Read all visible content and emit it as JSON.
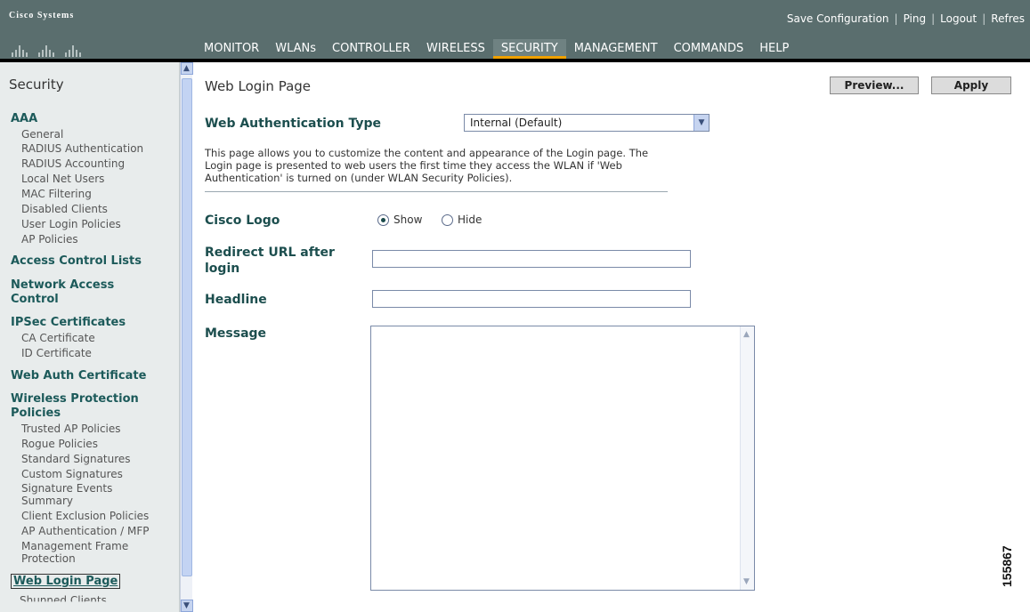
{
  "brand": {
    "name": "Cisco Systems"
  },
  "utility_links": [
    "Save Configuration",
    "Ping",
    "Logout",
    "Refres"
  ],
  "nav": {
    "items": [
      "MONITOR",
      "WLANs",
      "CONTROLLER",
      "WIRELESS",
      "SECURITY",
      "MANAGEMENT",
      "COMMANDS",
      "HELP"
    ],
    "active": "SECURITY"
  },
  "sidebar": {
    "title": "Security",
    "aaa": {
      "heading": "AAA",
      "items": [
        "General",
        "RADIUS Authentication",
        "RADIUS Accounting",
        "Local Net Users",
        "MAC Filtering",
        "Disabled Clients",
        "User Login Policies",
        "AP Policies"
      ]
    },
    "acl": "Access Control Lists",
    "nac": {
      "line1": "Network Access",
      "line2": "Control"
    },
    "ipsec": {
      "heading": "IPSec Certificates",
      "items": [
        "CA Certificate",
        "ID Certificate"
      ]
    },
    "webauth": "Web Auth Certificate",
    "wpp": {
      "line1": "Wireless Protection",
      "line2": "Policies",
      "items": [
        "Trusted AP Policies",
        "Rogue Policies",
        "Standard Signatures",
        "Custom Signatures",
        "Signature Events",
        "Summary",
        "Client Exclusion Policies",
        "AP Authentication / MFP",
        "Management Frame",
        "Protection"
      ]
    },
    "selected": "Web Login Page",
    "partial": "Shunned Clients"
  },
  "main": {
    "page_title": "Web Login Page",
    "preview_label": "Preview...",
    "apply_label": "Apply",
    "wat_label": "Web Authentication Type",
    "wat_value": "Internal (Default)",
    "description": "This page allows you to customize the content and appearance of the Login page. The Login page is presented to web users the first time they access the WLAN if 'Web Authentication' is turned on (under WLAN Security Policies).",
    "cisco_logo_label": "Cisco Logo",
    "show_label": "Show",
    "hide_label": "Hide",
    "logo_choice": "Show",
    "redirect_label_1": "Redirect URL after",
    "redirect_label_2": "login",
    "redirect_value": "",
    "headline_label": "Headline",
    "headline_value": "",
    "message_label": "Message",
    "message_value": ""
  },
  "figure_number": "155867",
  "colors": {
    "header": "#5a6e6e",
    "active_underline": "#f0a000",
    "label": "#1c4e4e",
    "sidebar_bg": "#e8ecec"
  }
}
